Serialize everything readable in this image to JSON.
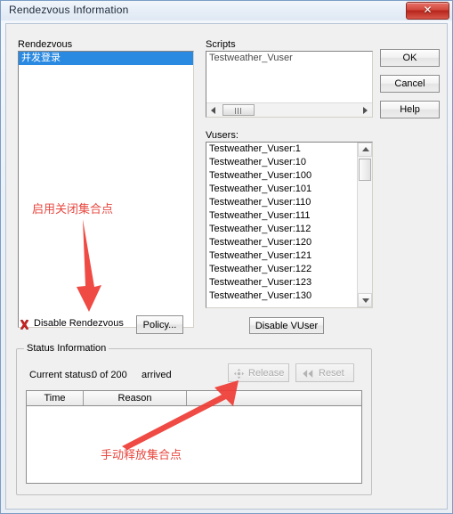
{
  "window": {
    "title": "Rendezvous Information",
    "close_label": "✕"
  },
  "rendezvous": {
    "label": "Rendezvous",
    "items": [
      {
        "label": "并发登录",
        "selected": true
      }
    ]
  },
  "scripts": {
    "label": "Scripts",
    "items": [
      {
        "label": "Testweather_Vuser"
      }
    ]
  },
  "vusers": {
    "label": "Vusers:",
    "items": [
      {
        "label": "Testweather_Vuser:1"
      },
      {
        "label": "Testweather_Vuser:10"
      },
      {
        "label": "Testweather_Vuser:100"
      },
      {
        "label": "Testweather_Vuser:101"
      },
      {
        "label": "Testweather_Vuser:110"
      },
      {
        "label": "Testweather_Vuser:111"
      },
      {
        "label": "Testweather_Vuser:112"
      },
      {
        "label": "Testweather_Vuser:120"
      },
      {
        "label": "Testweather_Vuser:121"
      },
      {
        "label": "Testweather_Vuser:122"
      },
      {
        "label": "Testweather_Vuser:123"
      },
      {
        "label": "Testweather_Vuser:130"
      }
    ]
  },
  "side_buttons": {
    "ok": "OK",
    "cancel": "Cancel",
    "help": "Help"
  },
  "actions": {
    "disable_rendezvous": "Disable Rendezvous",
    "policy": "Policy...",
    "disable_vuser": "Disable VUser"
  },
  "status_group": {
    "caption": "Status Information",
    "current_status_label": "Current status:",
    "current_status_value": "0 of 200",
    "arrived_label": "arrived",
    "release_button": "Release",
    "reset_button": "Reset",
    "table": {
      "columns": [
        "Time",
        "Reason",
        ""
      ],
      "rows": []
    }
  },
  "annotations": [
    {
      "text": "启用关闭集合点"
    },
    {
      "text": "手动释放集合点"
    }
  ],
  "colors": {
    "annotation": "#e8473f",
    "selection": "#2a8ae2",
    "close": "#c0392b"
  }
}
